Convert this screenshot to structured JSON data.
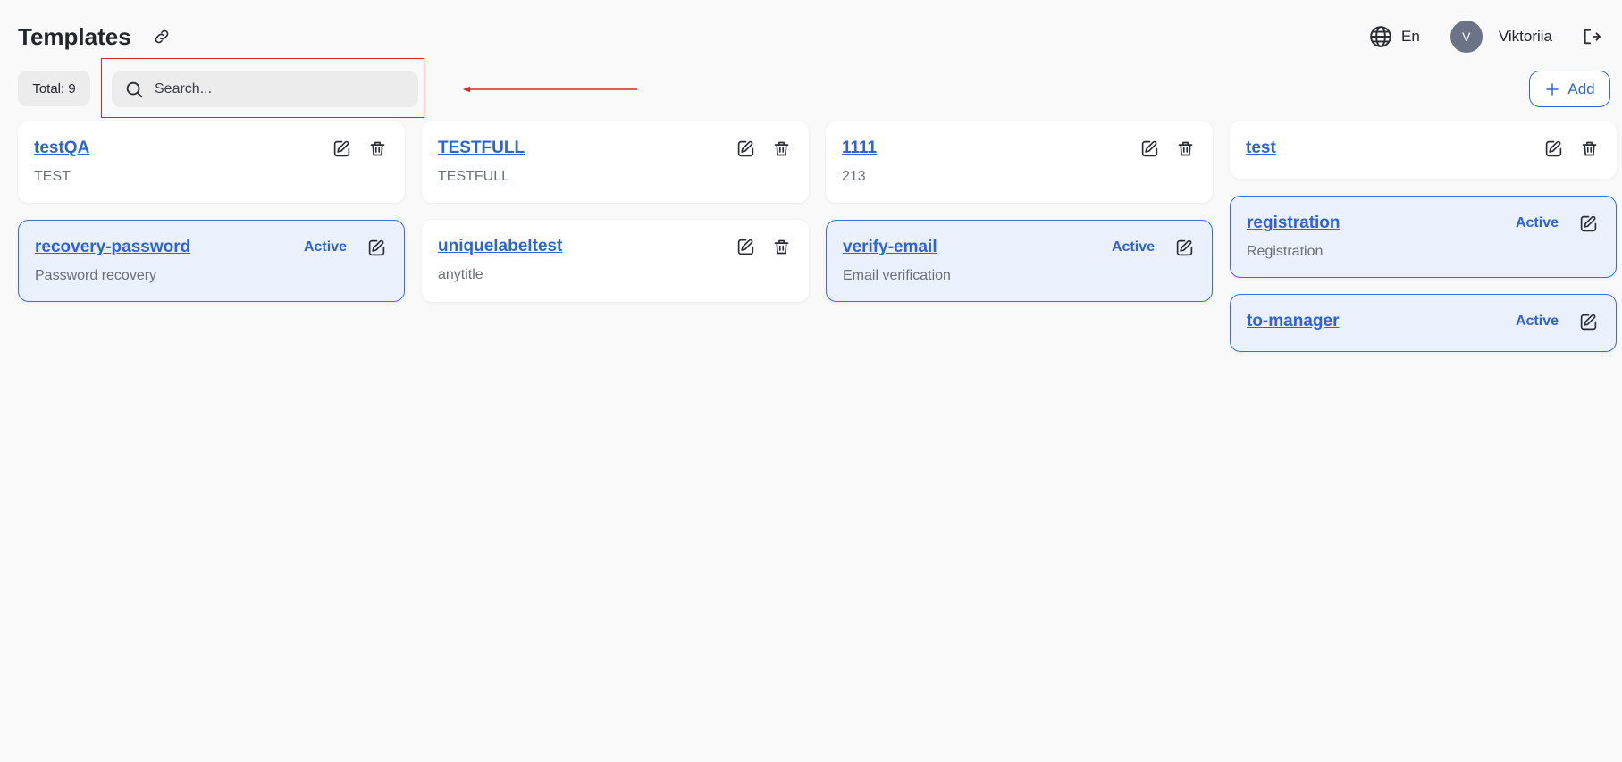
{
  "header": {
    "title": "Templates",
    "language": "En",
    "user_initial": "V",
    "user_name": "Viktoriia"
  },
  "toolbar": {
    "total_label": "Total: 9",
    "search_placeholder": "Search...",
    "search_value": "",
    "add_label": "Add"
  },
  "annotation": {
    "highlight_color": "#e02424"
  },
  "colors": {
    "accent": "#2b63d9",
    "active_card_bg": "#eaf0fc",
    "page_bg": "#f9f9f9"
  },
  "cards": [
    {
      "name": "testQA",
      "subtitle": "TEST",
      "active": false,
      "status": ""
    },
    {
      "name": "TESTFULL",
      "subtitle": "TESTFULL",
      "active": false,
      "status": ""
    },
    {
      "name": "1111",
      "subtitle": "213",
      "active": false,
      "status": ""
    },
    {
      "name": "test",
      "subtitle": "",
      "active": false,
      "status": ""
    },
    {
      "name": "recovery-password",
      "subtitle": "Password recovery",
      "active": true,
      "status": "Active"
    },
    {
      "name": "uniquelabeltest",
      "subtitle": "anytitle",
      "active": false,
      "status": ""
    },
    {
      "name": "verify-email",
      "subtitle": "Email verification",
      "active": true,
      "status": "Active"
    },
    {
      "name": "registration",
      "subtitle": "Registration",
      "active": true,
      "status": "Active"
    },
    {
      "name": "to-manager",
      "subtitle": "",
      "active": true,
      "status": "Active"
    }
  ]
}
